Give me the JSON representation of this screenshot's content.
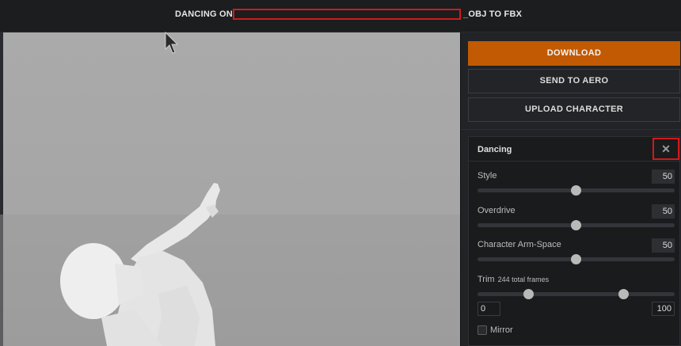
{
  "header": {
    "title_prefix": "DANCING ON",
    "title_suffix": "_OBJ TO FBX"
  },
  "actions": {
    "download": "DOWNLOAD",
    "send_to_aero": "SEND TO AERO",
    "upload_character": "UPLOAD CHARACTER"
  },
  "animation_panel": {
    "title": "Dancing",
    "close_glyph": "✕",
    "sliders": [
      {
        "label": "Style",
        "value": "50",
        "level": 0.5
      },
      {
        "label": "Overdrive",
        "value": "50",
        "level": 0.5
      },
      {
        "label": "Character Arm-Space",
        "value": "50",
        "level": 0.5
      }
    ],
    "trim": {
      "label": "Trim",
      "subtitle": "244 total frames",
      "start": "0",
      "end": "100",
      "range_levels": [
        0.26,
        0.74
      ]
    },
    "mirror": {
      "label": "Mirror",
      "checked": false
    }
  },
  "colors": {
    "accent": "#c15a02",
    "highlight_box": "#d11a1a",
    "panel_bg": "#222326",
    "viewport_bg": "#a6a6a6"
  },
  "icons": {
    "cursor": "arrow-cursor-icon",
    "close": "close-icon"
  }
}
